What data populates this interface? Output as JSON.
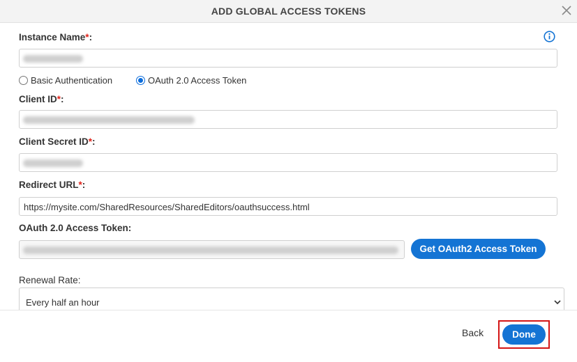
{
  "dialog": {
    "title": "ADD GLOBAL ACCESS TOKENS"
  },
  "instance_name": {
    "label": "Instance Name",
    "required_mark": "*",
    "suffix": ":",
    "value": ""
  },
  "auth_options": [
    {
      "label": "Basic Authentication",
      "checked": false
    },
    {
      "label": "OAuth 2.0 Access Token",
      "checked": true
    }
  ],
  "client_id": {
    "label": "Client ID",
    "required_mark": "*",
    "suffix": ":",
    "value": ""
  },
  "client_secret": {
    "label": "Client Secret ID",
    "required_mark": "*",
    "suffix": ":",
    "value": ""
  },
  "redirect_url": {
    "label": "Redirect URL",
    "required_mark": "*",
    "suffix": ":",
    "value": "https://mysite.com/SharedResources/SharedEditors/oauthsuccess.html"
  },
  "access_token": {
    "label": "OAuth 2.0 Access Token:",
    "value": "",
    "button_label": "Get OAuth2 Access Token"
  },
  "renewal_rate": {
    "label": "Renewal Rate:",
    "selected": "Every half an hour"
  },
  "footer": {
    "back_label": "Back",
    "done_label": "Done"
  },
  "colors": {
    "primary": "#1474d4",
    "required": "#e0241b",
    "highlight": "#d41515"
  }
}
